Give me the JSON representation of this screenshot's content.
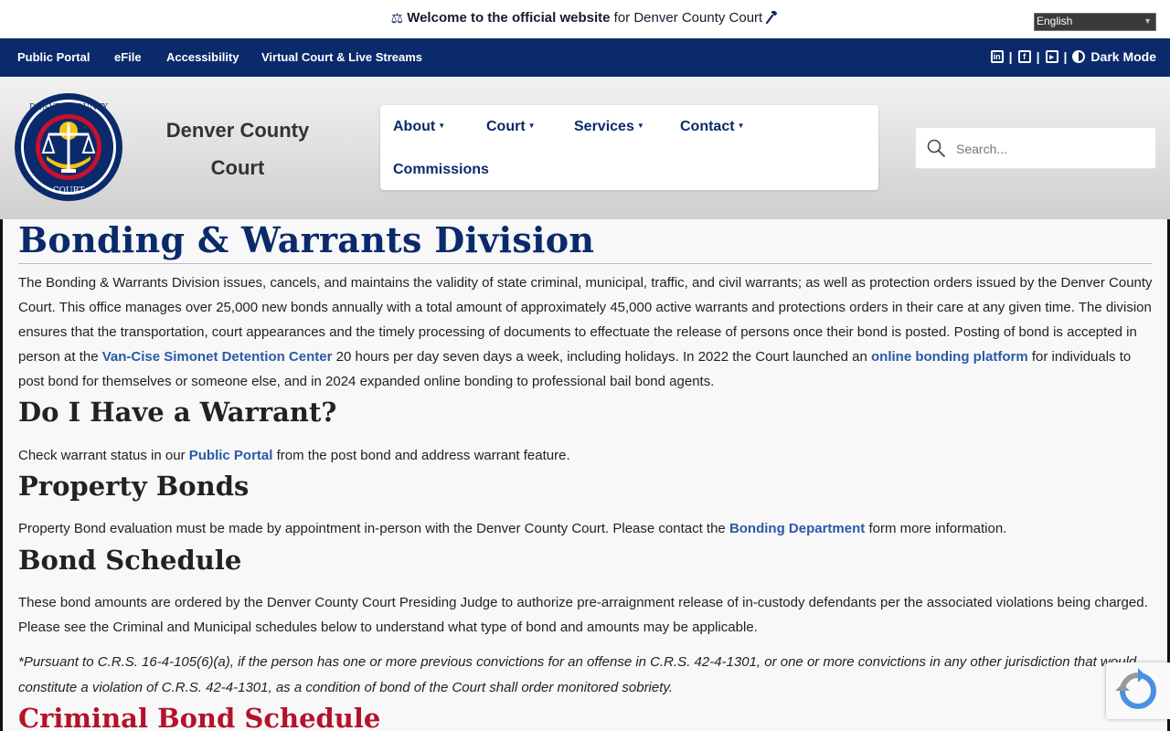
{
  "welcome": {
    "strong": "Welcome to the official website",
    "rest": "for Denver County Court"
  },
  "language": {
    "selected": "English"
  },
  "util_nav": {
    "links": [
      "Public Portal",
      "eFile",
      "Accessibility",
      "Virtual Court & Live Streams"
    ],
    "dark_mode": "Dark Mode"
  },
  "header": {
    "site_name": "Denver County Court",
    "seal_text_top": "DENVER COUNTY",
    "seal_text_bottom": "COURT"
  },
  "main_nav": {
    "items": [
      "About",
      "Court",
      "Services",
      "Contact",
      "Commissions"
    ]
  },
  "search": {
    "placeholder": "Search..."
  },
  "content": {
    "title": "Bonding & Warrants Division",
    "intro": {
      "part1": "The Bonding & Warrants Division issues, cancels, and maintains the validity of state criminal, municipal, traffic, and civil warrants; as well as protection orders issued by the Denver County Court. This office manages over 25,000 new bonds annually with a total amount of approximately 45,000 active warrants and protections orders in their care at any given time. The division ensures that the transportation, court appearances and the timely processing of documents to effectuate the release of persons once their bond is posted. Posting of bond is accepted in person at the ",
      "link1": "Van-Cise Simonet Detention Center",
      "part2": " 20 hours per day seven days a week, including holidays. In 2022 the Court launched an ",
      "link2": "online bonding platform",
      "part3": " for individuals to post bond for themselves or someone else, and in 2024 expanded online bonding to professional bail bond agents."
    },
    "warrant": {
      "heading": "Do I Have a Warrant?",
      "part1": "Check warrant status in our ",
      "link": "Public Portal",
      "part2": " from the post bond and address warrant feature."
    },
    "property": {
      "heading": "Property Bonds",
      "part1": "Property Bond evaluation must be made by appointment in-person with the Denver County Court. Please contact the ",
      "link": "Bonding Department",
      "part2": " form more information."
    },
    "schedule": {
      "heading": "Bond Schedule",
      "text": "These bond amounts are ordered by the Denver County Court Presiding Judge to authorize pre-arraignment release of in-custody defendants per the associated violations being charged. Please see the Criminal and Municipal schedules below to understand what type of bond and amounts may be applicable.",
      "note": "*Pursuant to C.R.S. 16-4-105(6)(a), if the person has one or more previous convictions for an offense in C.R.S. 42-4-1301, or one or more convictions in any other jurisdiction that would constitute a violation of C.R.S. 42-4-1301, as a condition of bond of the Court shall order monitored sobriety."
    },
    "criminal": {
      "heading": "Criminal Bond Schedule"
    }
  },
  "colors": {
    "navy": "#0b2a6b",
    "link": "#2a5aa8",
    "red_heading": "#b5122b"
  }
}
